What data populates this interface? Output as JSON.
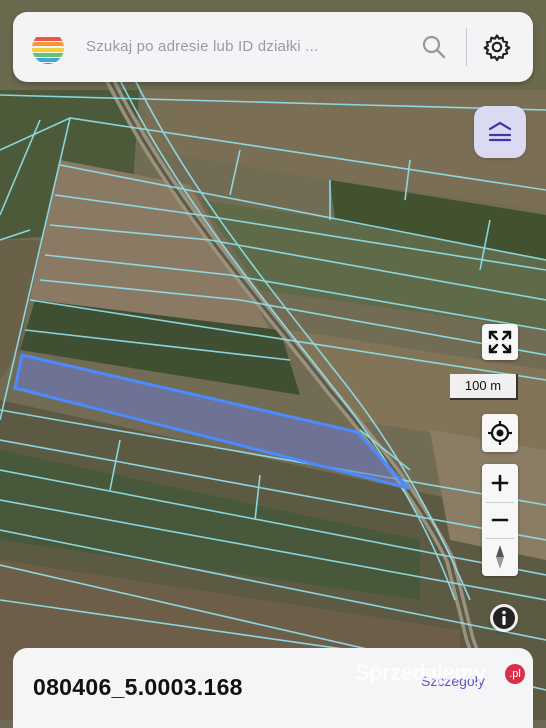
{
  "search": {
    "placeholder": "Szukaj po adresie lub ID działki ...",
    "logo_colors": [
      "#e9574f",
      "#f29a3a",
      "#f3cf3c",
      "#6cc26a",
      "#3fa7dd",
      "#6b62c9"
    ]
  },
  "icons": {
    "search": "search-icon",
    "settings": "gear-icon",
    "layers": "layers-icon",
    "fullscreen": "fullscreen-icon",
    "locate": "crosshair-icon",
    "zoom_in": "plus-icon",
    "zoom_out": "minus-icon",
    "compass": "compass-icon",
    "info": "info-icon"
  },
  "map": {
    "scale_label": "100 m",
    "parcel_outline_color": "#4a8bff",
    "boundary_color": "#8fe3f0"
  },
  "bottom_sheet": {
    "parcel_id": "080406_5.0003.168",
    "details_label": "Szczegóły"
  },
  "watermark": {
    "text": "Sprzedajemy",
    "badge": ".pl"
  },
  "colors": {
    "accent": "#5a55c2",
    "layers_bg": "#dcd9f3"
  }
}
